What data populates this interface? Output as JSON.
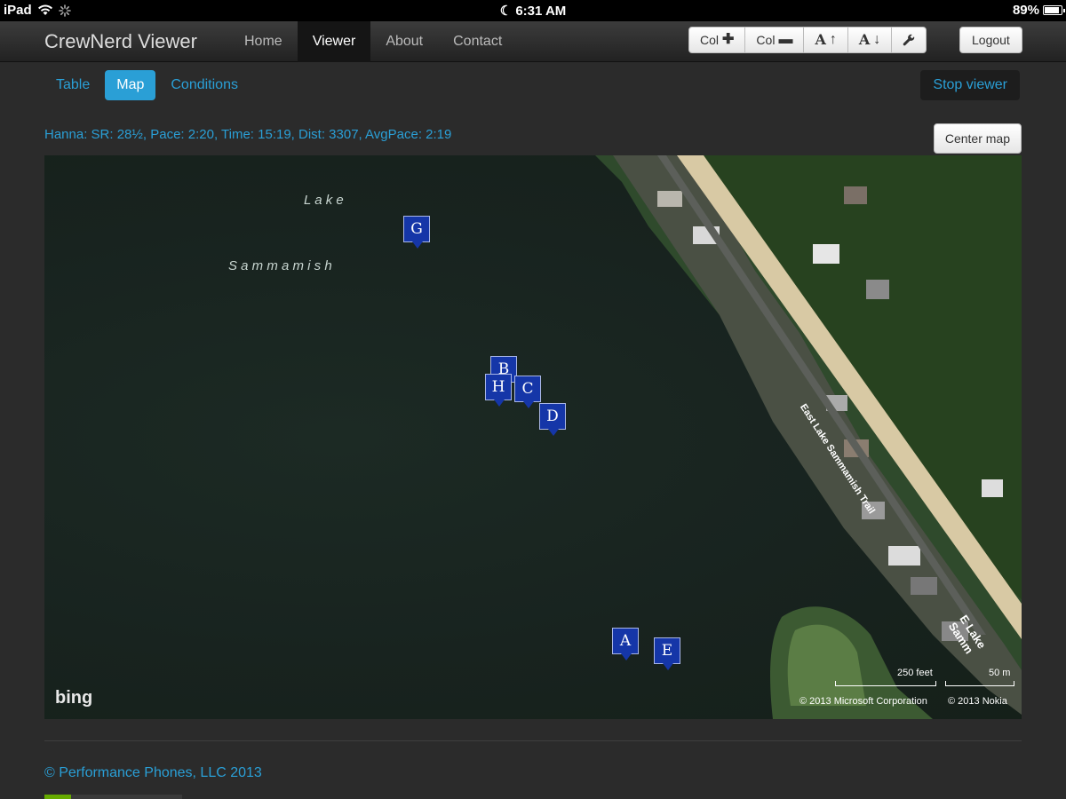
{
  "status": {
    "carrier": "iPad",
    "time": "6:31 AM",
    "battery": "89%",
    "battery_level": 0.89
  },
  "navbar": {
    "brand": "CrewNerd Viewer",
    "links": [
      {
        "label": "Home"
      },
      {
        "label": "Viewer",
        "active": true
      },
      {
        "label": "About"
      },
      {
        "label": "Contact"
      }
    ],
    "tools": {
      "col_add": "Col",
      "col_remove": "Col",
      "font_up": "A",
      "font_down": "A"
    },
    "logout": "Logout"
  },
  "subtabs": [
    {
      "label": "Table"
    },
    {
      "label": "Map",
      "active": true
    },
    {
      "label": "Conditions"
    }
  ],
  "stop_viewer": "Stop viewer",
  "stats": "Hanna: SR: 28½, Pace: 2:20, Time: 15:19, Dist: 3307, AvgPace: 2:19",
  "center_map": "Center map",
  "map": {
    "lake_label_1": "L a k e",
    "lake_label_2": "S a m m a m i s h",
    "trail_label": "East Lake Sammamish Trail",
    "road_label": "E Lake Samm",
    "markers": {
      "g": "G",
      "b": "B",
      "h": "H",
      "c": "C",
      "d": "D",
      "a": "A",
      "e": "E"
    },
    "logo": "bing",
    "scale_feet": "250 feet",
    "scale_m": "50 m",
    "copyright_ms": "© 2013 Microsoft Corporation",
    "copyright_nokia": "© 2013 Nokia"
  },
  "footer": "© Performance Phones, LLC 2013",
  "colors": {
    "accent": "#2a9fd6",
    "marker": "#1536a8",
    "water": "#1a2620"
  }
}
